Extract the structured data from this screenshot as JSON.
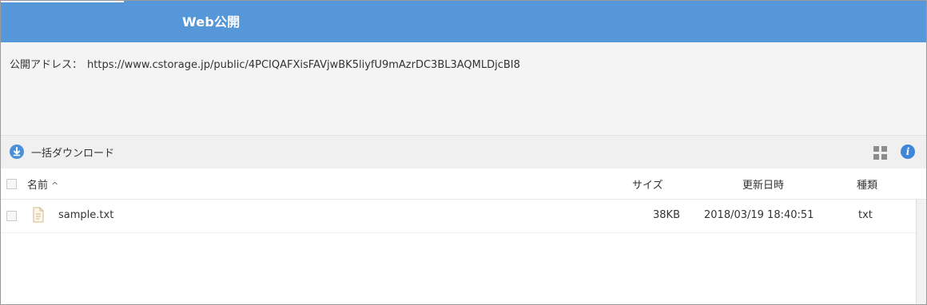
{
  "header": {
    "title": "Web公開"
  },
  "public_address": {
    "label": "公開アドレス：",
    "url": "https://www.cstorage.jp/public/4PCIQAFXisFAVjwBK5liyfU9mAzrDC3BL3AQMLDjcBI8"
  },
  "toolbar": {
    "bulk_download_label": "一括ダウンロード",
    "bulk_download_icon": "download-circle-icon",
    "grid_view_icon": "grid-view-icon",
    "info_icon": "info-icon",
    "info_glyph": "i"
  },
  "table": {
    "columns": {
      "name": "名前",
      "size": "サイズ",
      "updated": "更新日時",
      "type": "種類"
    },
    "sort_indicator": "^",
    "rows": [
      {
        "name": "sample.txt",
        "size": "38KB",
        "updated": "2018/03/19 18:40:51",
        "type": "txt",
        "icon": "text-file-icon"
      }
    ]
  },
  "colors": {
    "header_bg": "#5597d9",
    "accent_icon": "#3f86d6"
  }
}
